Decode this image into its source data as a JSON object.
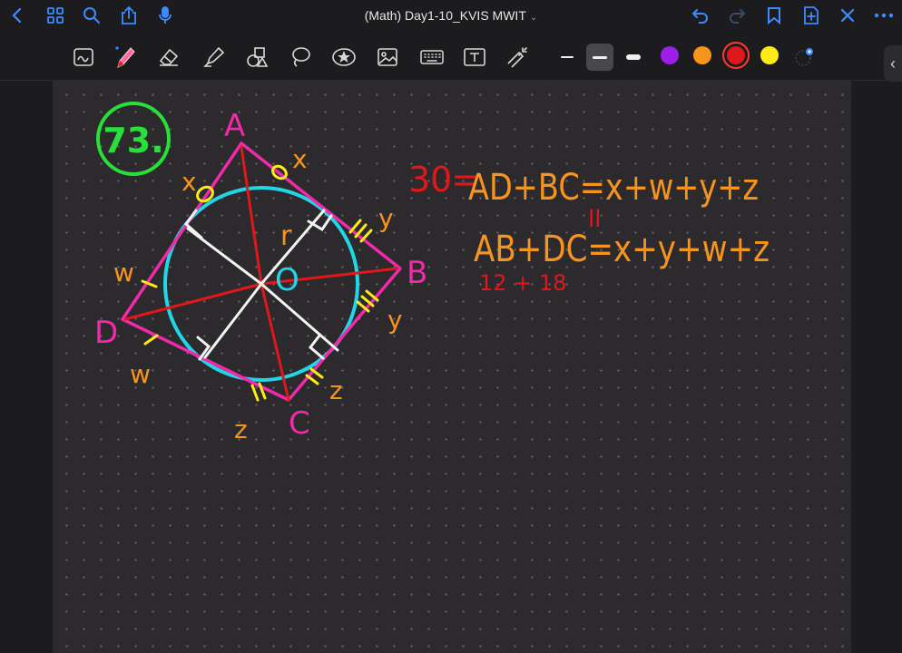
{
  "window": {
    "title": "(Math) Day1-10_KVIS MWIT",
    "title_caret": "⌄"
  },
  "nav_icons": [
    "back-icon",
    "grid-icon",
    "search-icon",
    "share-icon",
    "microphone-icon"
  ],
  "right_icons": [
    "undo-icon",
    "redo-icon",
    "bookmark-icon",
    "add-page-icon",
    "close-icon",
    "more-icon"
  ],
  "tools": [
    "lasso-text-icon",
    "pen-icon",
    "eraser-icon",
    "highlighter-icon",
    "shapes-icon",
    "lasso-icon",
    "sticker-icon",
    "image-icon",
    "keyboard-icon",
    "text-box-icon",
    "laser-pointer-icon"
  ],
  "swatches": [
    {
      "name": "purple",
      "color": "#9b1fe8"
    },
    {
      "name": "orange",
      "color": "#f7941d"
    },
    {
      "name": "red",
      "color": "#e0181b"
    },
    {
      "name": "yellow",
      "color": "#ffeb16"
    }
  ],
  "selected_color": "red",
  "notes": {
    "problem_number": "73.",
    "labels": {
      "A": "A",
      "B": "B",
      "C": "C",
      "D": "D",
      "O": "O",
      "r": "r",
      "x1": "x",
      "x2": "x",
      "y1": "y",
      "y2": "y",
      "w1": "w",
      "w2": "w",
      "z1": "z",
      "z2": "z"
    },
    "eq_red_value": "30",
    "eq_red_equals": "=",
    "eq1": "AD+BC=x+w+y+z",
    "parallel_mark": "ll",
    "eq2": "AB+DC=x+y+w+z",
    "sub_values": "12 + 18"
  },
  "colors": {
    "pink": "#f02aa8",
    "cyan": "#22d6e8",
    "red": "#e0181b",
    "orange": "#f7941d",
    "yellow": "#ffeb16",
    "green": "#27e03a",
    "white": "#f4f4f4",
    "accent": "#3d8bff"
  }
}
